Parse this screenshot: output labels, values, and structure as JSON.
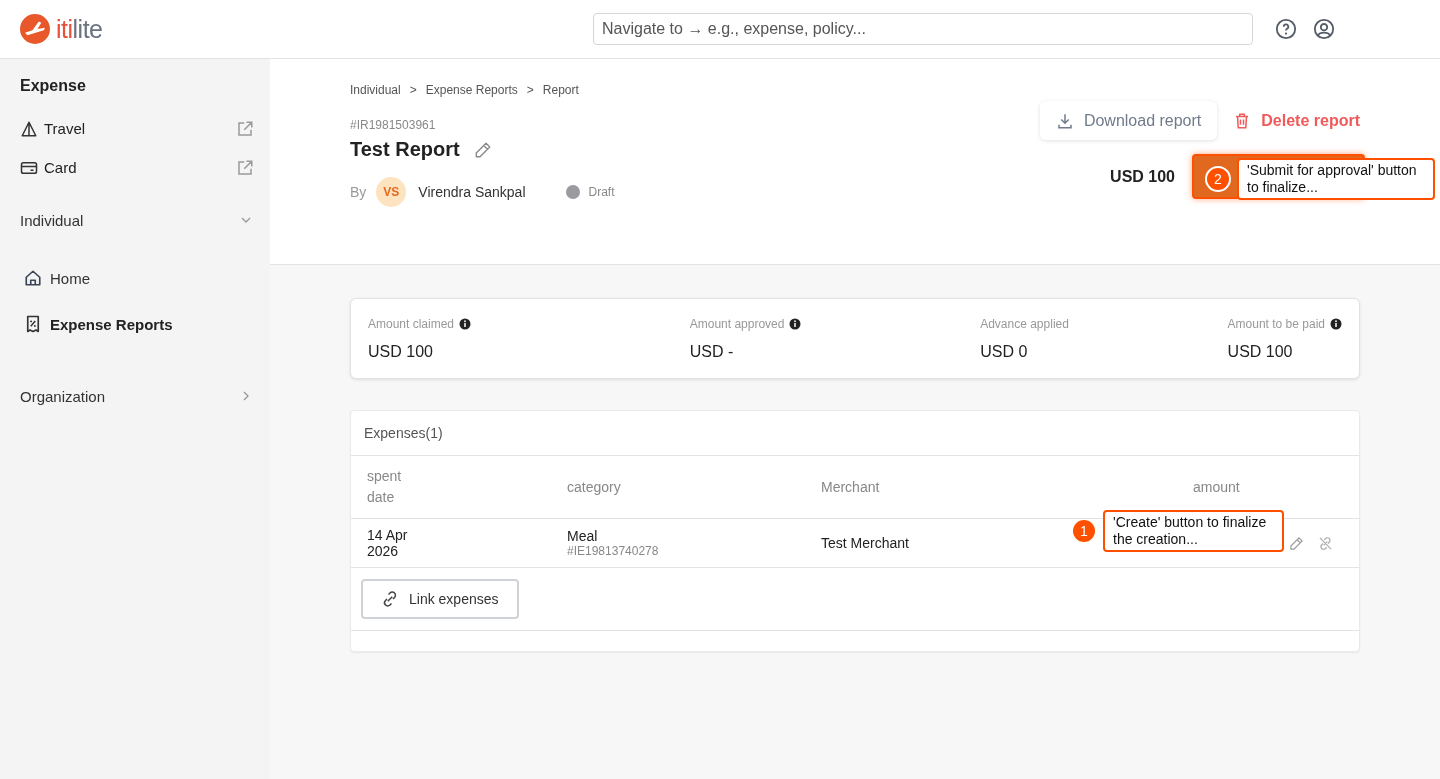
{
  "logo": {
    "parts": [
      "iti",
      "lite"
    ]
  },
  "search": {
    "placeholder": "Navigate to → e.g., expense, policy..."
  },
  "sidebar": {
    "heading": "Expense",
    "links": [
      {
        "label": "Travel",
        "kind": "travel"
      },
      {
        "label": "Card",
        "kind": "card"
      }
    ],
    "sections": [
      {
        "label": "Individual",
        "expanded": true,
        "items": [
          {
            "label": "Home",
            "kind": "home",
            "selected": false
          },
          {
            "label": "Expense Reports",
            "kind": "reports",
            "selected": true
          }
        ]
      },
      {
        "label": "Organization",
        "expanded": false
      }
    ]
  },
  "breadcrumb": {
    "items": [
      "Individual",
      "Expense Reports",
      "Report"
    ],
    "separator": ">"
  },
  "report": {
    "id": "#IR1981503961",
    "title": "Test Report",
    "by_label": "By",
    "owner_initials": "VS",
    "owner": "Virendra Sankpal",
    "status": "Draft",
    "total": "USD 100"
  },
  "actions": {
    "download": "Download report",
    "delete": "Delete report"
  },
  "summary": [
    {
      "label": "Amount claimed",
      "value": "USD 100",
      "info": true
    },
    {
      "label": "Amount approved",
      "value": "USD -",
      "info": true
    },
    {
      "label": "Advance applied",
      "value": "USD 0",
      "info": false
    },
    {
      "label": "Amount to be paid",
      "value": "USD 100",
      "info": true
    }
  ],
  "expenses": {
    "title": "Expenses(1)",
    "columns": [
      "spent date",
      "category",
      "Merchant",
      "amount"
    ],
    "rows": [
      {
        "date": "14 Apr 2026",
        "category": "Meal",
        "ref": "#IE19813740278",
        "merchant": "Test Merchant"
      }
    ],
    "link_button": "Link expenses"
  },
  "callouts": [
    {
      "number": "2",
      "text": "'Submit for approval' button to finalize..."
    },
    {
      "number": "1",
      "text": "'Create' button to finalize the creation..."
    }
  ]
}
